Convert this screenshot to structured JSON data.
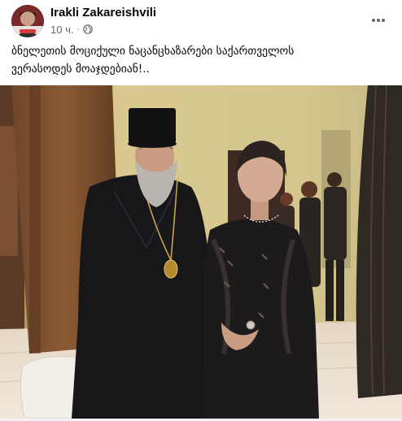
{
  "post": {
    "author": "Irakli Zakareishvili",
    "time": "10 ч.",
    "privacy_icon": "globe-icon",
    "more_icon": "more-options-icon",
    "text_line1": "ბნელეთის მოციქული ნაცანცხაზარები საქართველოს",
    "text_line2": "ვერასოდეს მოაჯდებიან!.."
  },
  "colors": {
    "author_text": "#050505",
    "meta_text": "#65676b",
    "wall": "#cdbe86",
    "floor": "#e9dccd"
  }
}
